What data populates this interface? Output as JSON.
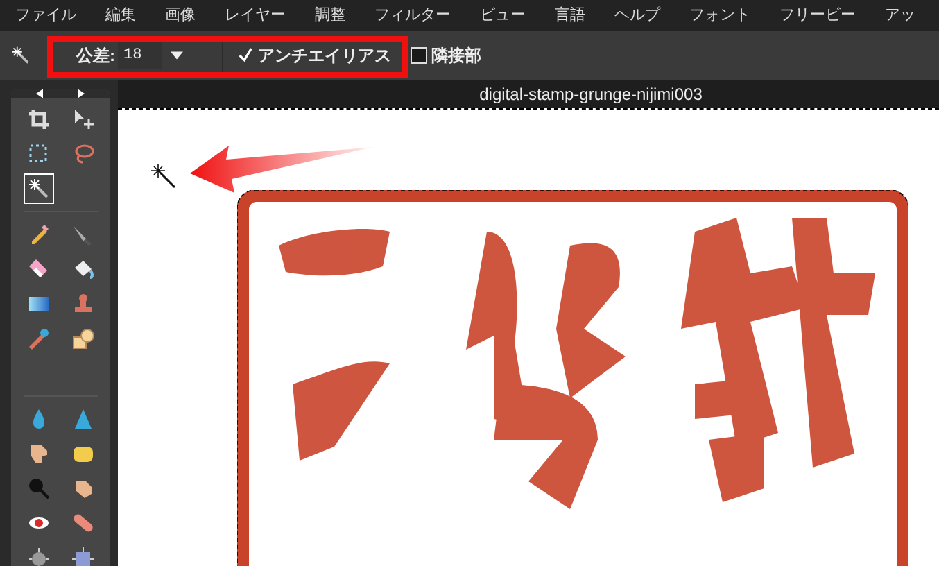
{
  "menu": [
    "ファイル",
    "編集",
    "画像",
    "レイヤー",
    "調整",
    "フィルター",
    "ビュー",
    "言語",
    "ヘルプ",
    "フォント",
    "フリービー",
    "アッ"
  ],
  "options": {
    "tolerance_label": "公差:",
    "tolerance_value": "18",
    "antialias": {
      "label": "アンチエイリアス",
      "checked": true
    },
    "contiguous": {
      "label": "隣接部",
      "checked": false
    }
  },
  "tools": [
    {
      "selected": false
    },
    {
      "selected": false
    },
    {
      "selected": false
    },
    {
      "selected": false
    },
    {
      "selected": true
    },
    {
      "selected": false
    },
    {
      "selected": false
    },
    {
      "selected": false
    },
    {
      "selected": false
    },
    {
      "selected": false
    },
    {
      "selected": false
    },
    {
      "selected": false
    },
    {
      "selected": false
    },
    {
      "selected": false
    },
    {
      "selected": false
    },
    {
      "selected": false
    },
    {
      "selected": false
    },
    {
      "selected": false
    },
    {
      "selected": false
    },
    {
      "selected": false
    },
    {
      "selected": false
    },
    {
      "selected": false
    },
    {
      "selected": false
    }
  ],
  "document": {
    "title": "digital-stamp-grunge-nijimi003"
  }
}
